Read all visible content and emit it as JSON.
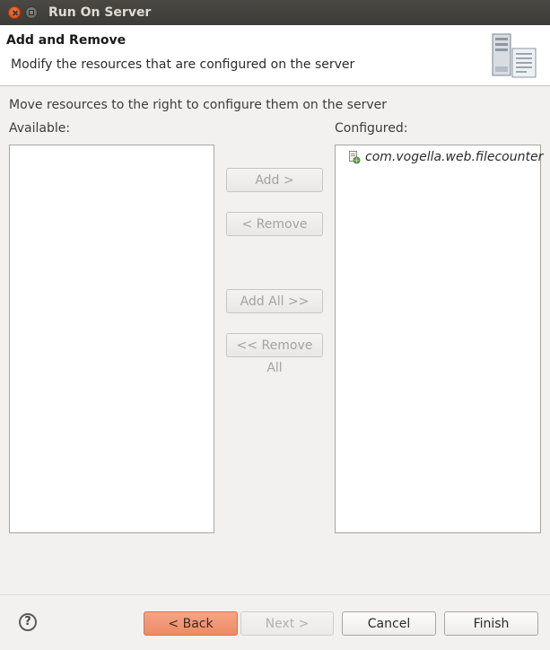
{
  "window": {
    "title": "Run On Server"
  },
  "banner": {
    "title": "Add and Remove",
    "description": "Modify the resources that are configured on the server",
    "icon": "server-icon"
  },
  "instruction": "Move resources to the right to configure them on the server",
  "available": {
    "label": "Available:",
    "items": []
  },
  "configured": {
    "label": "Configured:",
    "items": [
      {
        "label": "com.vogella.web.filecounter",
        "icon": "web-project-icon"
      }
    ]
  },
  "actions": {
    "add": "Add >",
    "remove": "< Remove",
    "add_all": "Add All >>",
    "remove_all": "<< Remove All"
  },
  "footer": {
    "help": "?",
    "back": "< Back",
    "next": "Next >",
    "cancel": "Cancel",
    "finish": "Finish"
  },
  "colors": {
    "accent": "#ee8a64",
    "titlebar": "#3c3b37",
    "close_button": "#dd4814"
  }
}
